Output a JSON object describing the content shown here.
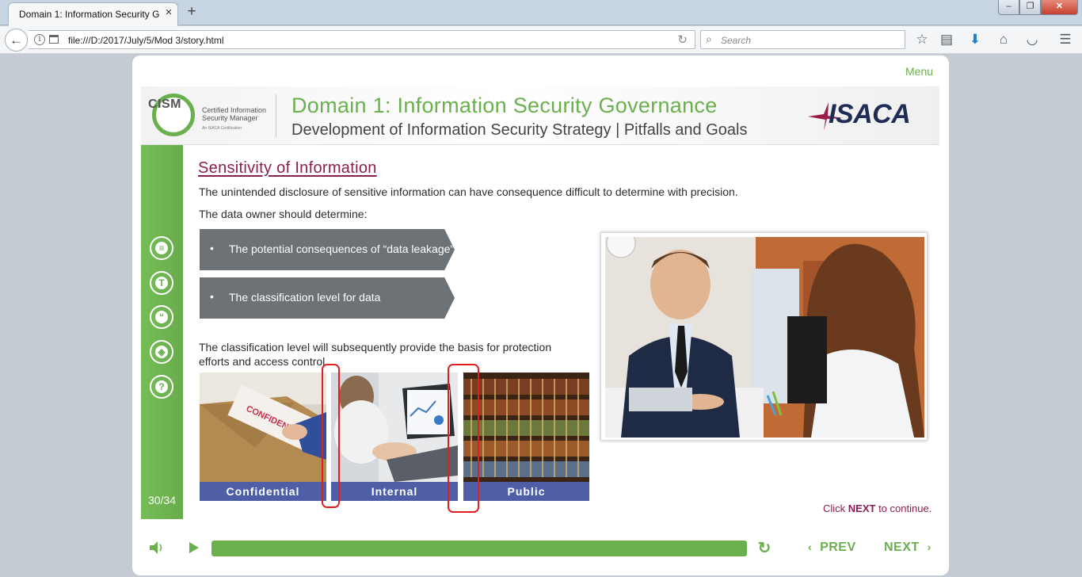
{
  "browser": {
    "tab_title": "Domain 1: Information Security G",
    "tab_close": "×",
    "new_tab": "+",
    "url": "file:///D:/2017/July/5/Mod 3/story.html",
    "search_placeholder": "Search",
    "window_buttons": {
      "minimize": "–",
      "maximize": "❐",
      "close": "✕"
    }
  },
  "player": {
    "menu_label": "Menu",
    "banner": {
      "cism_acronym": "CISM",
      "cism_line1": "Certified Information",
      "cism_line2": "Security Manager",
      "cism_sub": "An ISACA Certification",
      "title": "Domain 1: Information Security Governance",
      "subtitle": "Development of Information Security Strategy | Pitfalls and Goals",
      "isaca_logo": "ISACA"
    },
    "sidebar": {
      "buttons": [
        {
          "icon": "notes-icon",
          "glyph": "≡"
        },
        {
          "icon": "transcript-icon",
          "glyph": "T"
        },
        {
          "icon": "quote-icon",
          "glyph": "“"
        },
        {
          "icon": "layers-icon",
          "glyph": "◈"
        },
        {
          "icon": "help-icon",
          "glyph": "?"
        }
      ],
      "slide_counter": "30/34"
    },
    "slide": {
      "heading": "Sensitivity of Information",
      "intro": "The unintended disclosure of sensitive information can have consequence difficult to determine with precision.",
      "owner_prompt": "The data owner should determine:",
      "bullets": [
        "The potential consequences of “data leakage”",
        "The classification level for data"
      ],
      "bullet_glyph": "•",
      "basis_text": "The classification level will subsequently provide the basis for protection efforts and access control.",
      "classifications": [
        "Confidential",
        "Internal",
        "Public"
      ],
      "envelope_stamp": "CONFIDENTIAL",
      "continue": {
        "prefix": "Click ",
        "keyword": "NEXT",
        "suffix": " to continue."
      }
    },
    "controls": {
      "progress_fraction": 1.0,
      "prev_label": "PREV",
      "next_label": "NEXT",
      "prev_glyph": "‹",
      "next_glyph": "›"
    },
    "colors": {
      "accent_green": "#6ab04c",
      "heading_maroon": "#8b1d53",
      "label_blue": "#4e5fa8",
      "arrow_gray": "#6d7277",
      "marker_red": "#e02020"
    }
  }
}
